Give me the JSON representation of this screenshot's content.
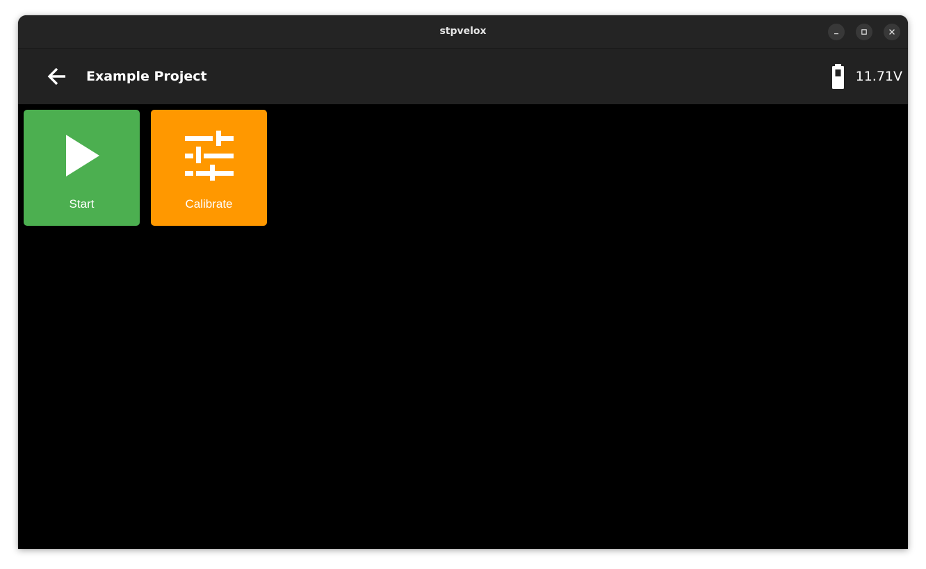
{
  "window": {
    "title": "stpvelox"
  },
  "appbar": {
    "title": "Example Project",
    "voltage": "11.71V"
  },
  "tiles": [
    {
      "label": "Start",
      "color": "#4caf50",
      "icon": "play-icon"
    },
    {
      "label": "Calibrate",
      "color": "#ff9800",
      "icon": "tune-icon"
    }
  ],
  "colors": {
    "titlebar": "#242424",
    "appbar": "#222222",
    "background": "#000000"
  }
}
